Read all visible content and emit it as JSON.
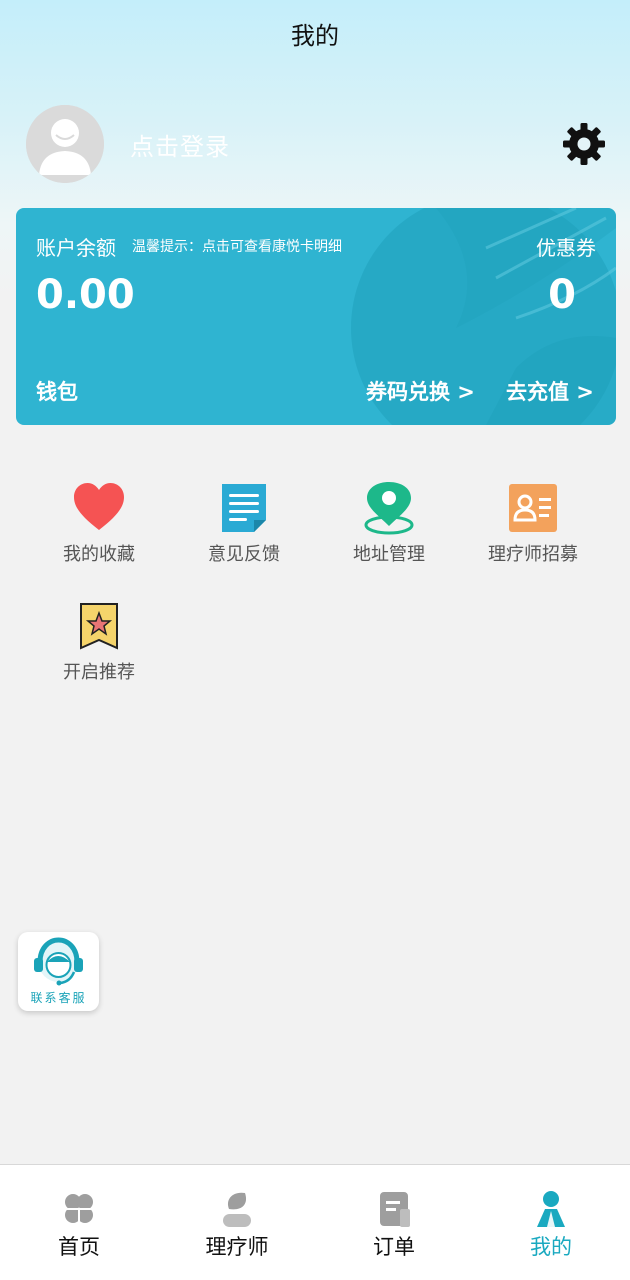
{
  "header": {
    "title": "我的"
  },
  "profile": {
    "login_prompt": "点击登录"
  },
  "icons": {
    "avatar": "default-user-avatar",
    "settings": "gear-icon",
    "favorites": "heart-icon",
    "feedback": "document-icon",
    "address": "location-pin-icon",
    "recruit": "id-card-icon",
    "recommend": "star-badge-icon",
    "service": "customer-service-headset-icon"
  },
  "account_card": {
    "balance_label": "账户余额",
    "tip": "温馨提示：点击可查看康悦卡明细",
    "balance_value": "0.00",
    "coupon_label": "优惠券",
    "coupon_value": "0",
    "wallet_label": "钱包",
    "redeem_label": "券码兑换 >",
    "recharge_label": "去充值 >"
  },
  "menu": [
    {
      "label": "我的收藏"
    },
    {
      "label": "意见反馈"
    },
    {
      "label": "地址管理"
    },
    {
      "label": "理疗师招募"
    },
    {
      "label": "开启推荐"
    }
  ],
  "service": {
    "label": "联系客服"
  },
  "tabbar": [
    {
      "label": "首页"
    },
    {
      "label": "理疗师"
    },
    {
      "label": "订单"
    },
    {
      "label": "我的",
      "active": true
    }
  ],
  "colors": {
    "card": "#2fb4d1",
    "accent": "#1aa9c0",
    "heart": "#f55353",
    "feedback": "#2aaad4",
    "address": "#1db88a",
    "recruit": "#f3a25c",
    "recommend": "#f5d46b"
  }
}
